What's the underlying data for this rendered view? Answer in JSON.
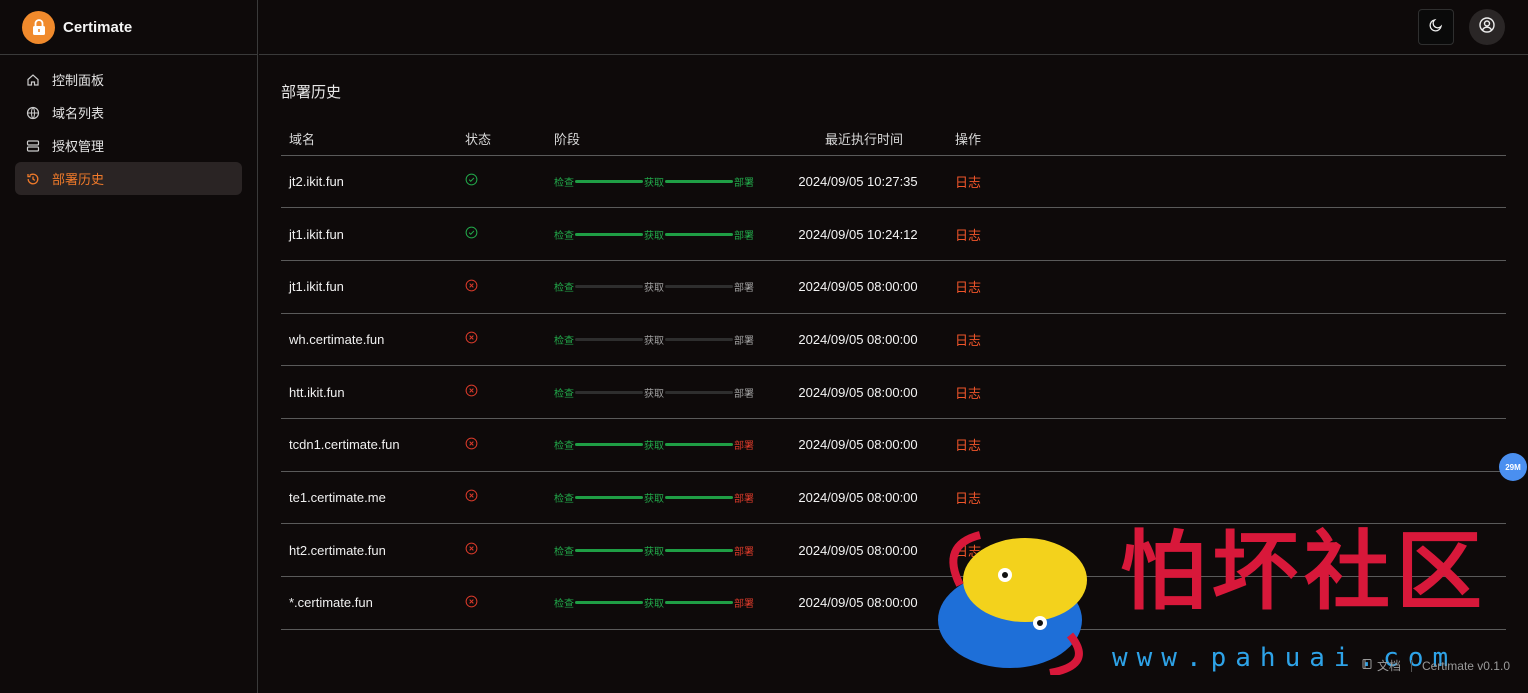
{
  "app": {
    "name": "Certimate"
  },
  "sidebar": {
    "items": [
      {
        "label": "控制面板",
        "icon": "home-icon",
        "active": false
      },
      {
        "label": "域名列表",
        "icon": "globe-icon",
        "active": false
      },
      {
        "label": "授权管理",
        "icon": "server-icon",
        "active": false
      },
      {
        "label": "部署历史",
        "icon": "history-icon",
        "active": true
      }
    ]
  },
  "topbar": {
    "theme_icon": "moon-icon",
    "user_icon": "user-circle-icon"
  },
  "main": {
    "title": "部署历史",
    "columns": [
      "域名",
      "状态",
      "阶段",
      "最近执行时间",
      "操作"
    ],
    "rows": [
      {
        "domain": "jt2.ikit.fun",
        "status": "success",
        "stages": [
          "检查",
          "获取",
          "部署"
        ],
        "stage_state": [
          "green",
          "green",
          "green"
        ],
        "bar_state": [
          "green",
          "green"
        ],
        "time": "2024/09/05 10:27:35",
        "action": "日志"
      },
      {
        "domain": "jt1.ikit.fun",
        "status": "success",
        "stages": [
          "检查",
          "获取",
          "部署"
        ],
        "stage_state": [
          "green",
          "green",
          "green"
        ],
        "bar_state": [
          "green",
          "green"
        ],
        "time": "2024/09/05 10:24:12",
        "action": "日志"
      },
      {
        "domain": "jt1.ikit.fun",
        "status": "failed",
        "stages": [
          "检查",
          "获取",
          "部署"
        ],
        "stage_state": [
          "green",
          "gray",
          "gray"
        ],
        "bar_state": [
          "gray",
          "gray"
        ],
        "time": "2024/09/05 08:00:00",
        "action": "日志"
      },
      {
        "domain": "wh.certimate.fun",
        "status": "failed",
        "stages": [
          "检查",
          "获取",
          "部署"
        ],
        "stage_state": [
          "green",
          "gray",
          "gray"
        ],
        "bar_state": [
          "gray",
          "gray"
        ],
        "time": "2024/09/05 08:00:00",
        "action": "日志"
      },
      {
        "domain": "htt.ikit.fun",
        "status": "failed",
        "stages": [
          "检查",
          "获取",
          "部署"
        ],
        "stage_state": [
          "green",
          "gray",
          "gray"
        ],
        "bar_state": [
          "gray",
          "gray"
        ],
        "time": "2024/09/05 08:00:00",
        "action": "日志"
      },
      {
        "domain": "tcdn1.certimate.fun",
        "status": "failed",
        "stages": [
          "检查",
          "获取",
          "部署"
        ],
        "stage_state": [
          "green",
          "green",
          "red"
        ],
        "bar_state": [
          "green",
          "green"
        ],
        "time": "2024/09/05 08:00:00",
        "action": "日志"
      },
      {
        "domain": "te1.certimate.me",
        "status": "failed",
        "stages": [
          "检查",
          "获取",
          "部署"
        ],
        "stage_state": [
          "green",
          "green",
          "red"
        ],
        "bar_state": [
          "green",
          "green"
        ],
        "time": "2024/09/05 08:00:00",
        "action": "日志"
      },
      {
        "domain": "ht2.certimate.fun",
        "status": "failed",
        "stages": [
          "检查",
          "获取",
          "部署"
        ],
        "stage_state": [
          "green",
          "green",
          "red"
        ],
        "bar_state": [
          "green",
          "green"
        ],
        "time": "2024/09/05 08:00:00",
        "action": "日志"
      },
      {
        "domain": "*.certimate.fun",
        "status": "failed",
        "stages": [
          "检查",
          "获取",
          "部署"
        ],
        "stage_state": [
          "green",
          "green",
          "red"
        ],
        "bar_state": [
          "green",
          "green"
        ],
        "time": "2024/09/05 08:00:00",
        "action": "日志"
      }
    ]
  },
  "float_badge": {
    "label": "29M"
  },
  "footer": {
    "docs_label": "文档",
    "version": "Certimate v0.1.0"
  },
  "watermark": {
    "text": "怕坏社区",
    "url": "www.pahuai.com"
  },
  "colors": {
    "accent": "#f07a2a",
    "success": "#22a84a",
    "danger": "#d93a2a",
    "link": "#f0552a"
  }
}
